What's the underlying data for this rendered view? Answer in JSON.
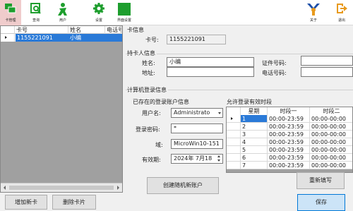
{
  "toolbar": {
    "items": [
      {
        "label": "卡管理",
        "icon": "card-management-icon"
      },
      {
        "label": "查询",
        "icon": "query-icon"
      },
      {
        "label": "用户",
        "icon": "user-icon"
      },
      {
        "label": "设置",
        "icon": "gear-icon"
      },
      {
        "label": "界面设置",
        "icon": "ui-settings-icon"
      },
      {
        "label": "关于",
        "icon": "about-icon"
      },
      {
        "label": "退出",
        "icon": "exit-icon"
      }
    ]
  },
  "card_list": {
    "columns": [
      "卡号",
      "姓名",
      "电话号"
    ],
    "rows": [
      {
        "card_no": "1155221091",
        "name": "小编"
      }
    ]
  },
  "left_buttons": {
    "add": "增加新卡",
    "delete": "删除卡片"
  },
  "card_info": {
    "title": "卡信息",
    "card_no_label": "卡号:",
    "card_no": "1155221091"
  },
  "holder_info": {
    "title": "持卡人信息",
    "name_label": "姓名:",
    "name": "小编",
    "id_label": "证件号码:",
    "id": "",
    "address_label": "地址:",
    "address": "",
    "phone_label": "电话号码:",
    "phone": ""
  },
  "login_info": {
    "title": "计算机登录信息",
    "existing_title": "已存在的登录账户信息",
    "username_label": "用户名:",
    "username": "Administrato",
    "password_label": "登录密码:",
    "password": "*",
    "domain_label": "域:",
    "domain": "MicroWin10-151",
    "expiry_label": "有效期:",
    "expiry": "2024年 7月18",
    "create_button": "创建随机新账户"
  },
  "periods": {
    "title": "允许登录有效时段",
    "columns": [
      "星期",
      "时段一",
      "时段二"
    ],
    "rows": [
      {
        "day": "1",
        "p1": "00:00-23:59",
        "p2": "00:00-00:00"
      },
      {
        "day": "2",
        "p1": "00:00-23:59",
        "p2": "00:00-00:00"
      },
      {
        "day": "3",
        "p1": "00:00-23:59",
        "p2": "00:00-00:00"
      },
      {
        "day": "4",
        "p1": "00:00-23:59",
        "p2": "00:00-00:00"
      },
      {
        "day": "5",
        "p1": "00:00-23:59",
        "p2": "00:00-00:00"
      },
      {
        "day": "6",
        "p1": "00:00-23:59",
        "p2": "00:00-00:00"
      },
      {
        "day": "7",
        "p1": "00:00-23:59",
        "p2": "00:00-00:00"
      }
    ],
    "refill_button": "重新填写"
  },
  "save_button": "保存",
  "colors": {
    "selection": "#2a7ad8",
    "toolbar_active": "#f0cccc",
    "icon_green": "#1e9e2e",
    "icon_blue": "#1d4fa8",
    "icon_orange": "#e89a1c"
  }
}
